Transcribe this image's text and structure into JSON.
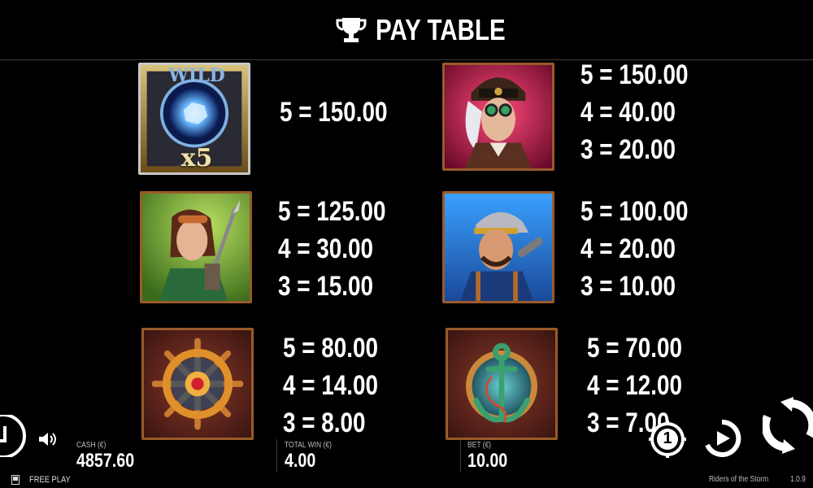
{
  "header": {
    "title": "PAY TABLE",
    "icon": "trophy-icon"
  },
  "symbols": [
    {
      "name": "wild-symbol",
      "wild_label": "WILD",
      "multiplier_label": "x5",
      "payouts": [
        "5 = 150.00"
      ]
    },
    {
      "name": "aviator-woman-symbol",
      "payouts": [
        "5 = 150.00",
        "4 = 40.00",
        "3 = 20.00"
      ]
    },
    {
      "name": "spear-woman-symbol",
      "payouts": [
        "5 = 125.00",
        "4 = 30.00",
        "3 = 15.00"
      ]
    },
    {
      "name": "mechanic-man-symbol",
      "payouts": [
        "5 = 100.00",
        "4 = 20.00",
        "3 = 10.00"
      ]
    },
    {
      "name": "ship-wheel-symbol",
      "payouts": [
        "5 = 80.00",
        "4 = 14.00",
        "3 = 8.00"
      ]
    },
    {
      "name": "anchor-symbol",
      "payouts": [
        "5 = 70.00",
        "4 = 12.00",
        "3 = 7.00"
      ]
    }
  ],
  "meters": {
    "cash": {
      "label": "CASH (€)",
      "value": "4857.60"
    },
    "total_win": {
      "label": "TOTAL WIN (€)",
      "value": "4.00"
    },
    "bet": {
      "label": "BET (€)",
      "value": "10.00"
    }
  },
  "footer": {
    "mode": "FREE PLAY",
    "game_name": "Riders of the Storm",
    "version": "1.0.9"
  },
  "controls": {
    "coin_label": "1",
    "icons": [
      "back-icon",
      "sound-icon",
      "coin-value-icon",
      "autoplay-icon",
      "spin-icon"
    ]
  },
  "colors": {
    "frame": "#9a5a2a",
    "background": "#000000",
    "text": "#ffffff"
  }
}
